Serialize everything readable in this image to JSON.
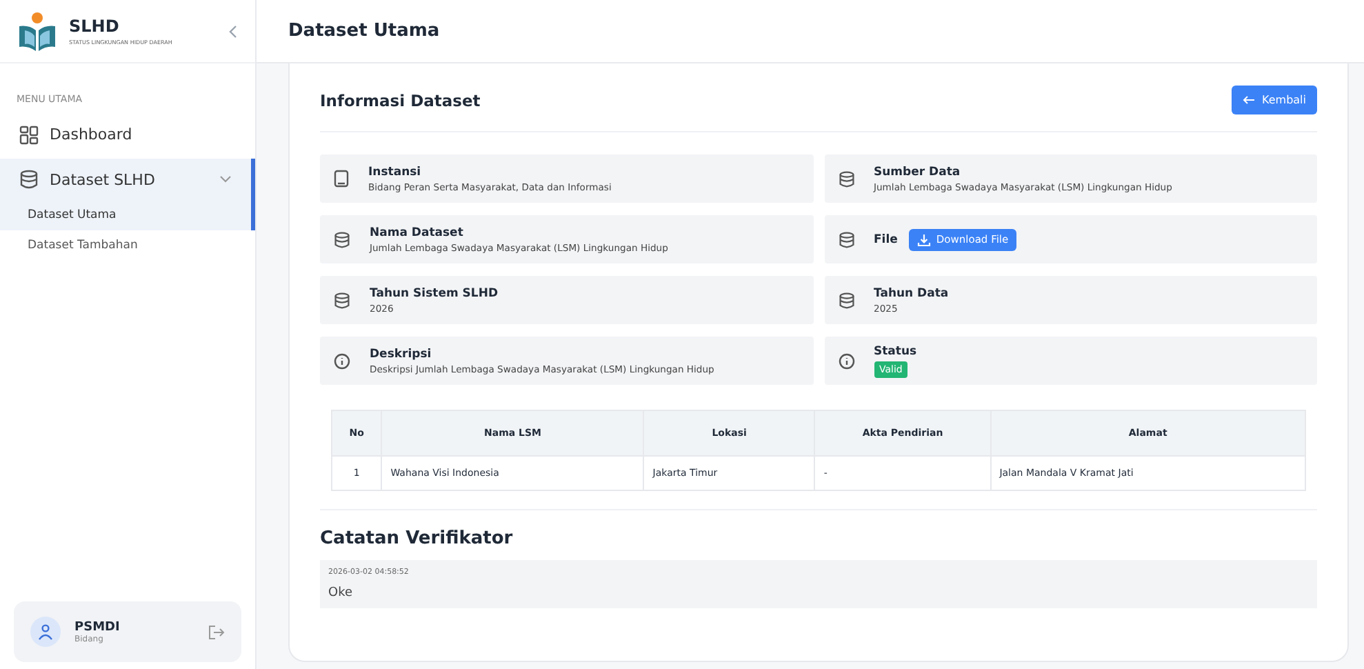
{
  "sidebar": {
    "logo_title": "SLHD",
    "logo_subtitle": "STATUS LINGKUNGAN HIDUP DAERAH",
    "section_label": "MENU UTAMA",
    "items": [
      {
        "label": "Dashboard",
        "selected": false
      },
      {
        "label": "Dataset SLHD",
        "selected": true,
        "expanded": true,
        "children": [
          {
            "label": "Dataset Utama",
            "selected": true
          },
          {
            "label": "Dataset Tambahan",
            "selected": false
          }
        ]
      }
    ],
    "user": {
      "name": "PSMDI",
      "role": "Bidang"
    }
  },
  "header": {
    "title": "Dataset Utama"
  },
  "card": {
    "title": "Informasi Dataset",
    "back_button": "Kembali",
    "fields": [
      {
        "kind": "text",
        "label": "Instansi",
        "value": "Bidang Peran Serta Masyarakat, Data dan Informasi"
      },
      {
        "kind": "text",
        "label": "Sumber Data",
        "value": "Jumlah Lembaga Swadaya Masyarakat (LSM) Lingkungan Hidup"
      },
      {
        "kind": "text",
        "label": "Nama Dataset",
        "value": "Jumlah Lembaga Swadaya Masyarakat (LSM) Lingkungan Hidup"
      },
      {
        "kind": "file",
        "label": "File",
        "value": "Download File"
      },
      {
        "kind": "text",
        "label": "Tahun Sistem SLHD",
        "value": "2026"
      },
      {
        "kind": "text",
        "label": "Tahun Data",
        "value": "2025"
      },
      {
        "kind": "text",
        "label": "Deskripsi",
        "value": "Deskripsi Jumlah Lembaga Swadaya Masyarakat (LSM) Lingkungan Hidup"
      },
      {
        "kind": "status",
        "label": "Status",
        "value": "Valid"
      }
    ],
    "table": {
      "columns": [
        "No",
        "Nama LSM",
        "Lokasi",
        "Akta Pendirian",
        "Alamat"
      ],
      "rows": [
        [
          "1",
          "Wahana Visi Indonesia",
          "Jakarta Timur",
          "-",
          "Jalan Mandala V Kramat Jati"
        ]
      ]
    },
    "notes_title": "Catatan Verifikator",
    "notes": [
      {
        "timestamp": "2026-03-02 04:58:52",
        "text": "Oke"
      }
    ]
  }
}
